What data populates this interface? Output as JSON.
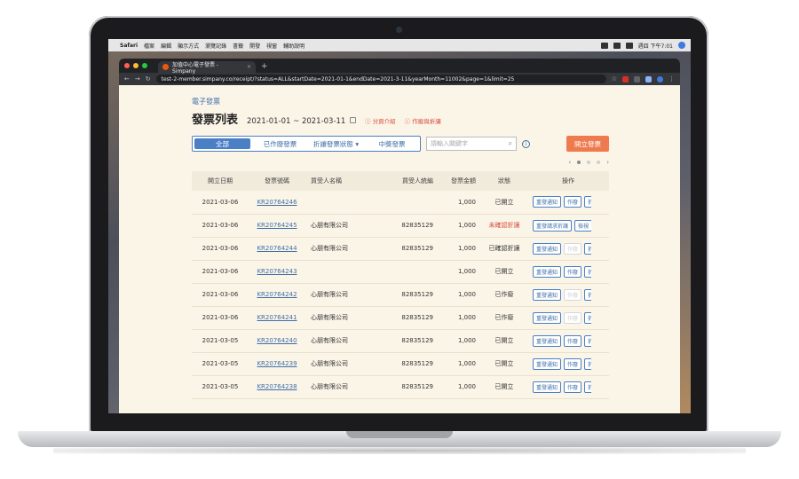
{
  "menubar": {
    "apple": "",
    "app": "Safari",
    "items": [
      "檔案",
      "編輯",
      "顯示方式",
      "瀏覽記錄",
      "書籤",
      "開發",
      "視窗",
      "輔助說明"
    ],
    "clock": "週四 下午7:01"
  },
  "browser": {
    "tab_title": "加值中心電子發票 - Simpany",
    "url": "test-2-member.simpany.co/receipt/?status=ALL&startDate=2021-01-1&endDate=2021-3-11&yearMonth=11002&page=1&limit=25"
  },
  "page": {
    "breadcrumb": "電子發票",
    "title": "發票列表",
    "date_range": "2021-01-01 ~ 2021-03-11",
    "links": [
      "分頁介紹",
      "作廢與折讓"
    ],
    "filters": [
      "全部",
      "已作廢發票",
      "折讓發票狀態",
      "中獎發票"
    ],
    "search_placeholder": "請輸入關鍵字",
    "issue_button": "開立發票"
  },
  "table": {
    "headers": [
      "開立日期",
      "發票號碼",
      "買受人名稱",
      "買受人統編",
      "發票金額",
      "狀態",
      "操作"
    ],
    "rows": [
      {
        "date": "2021-03-06",
        "no": "KR20764246",
        "buyer": "",
        "tax": "",
        "amt": "1,000",
        "status": "已開立",
        "red": false,
        "b1": "重發通知",
        "b2": "作廢",
        "b3": "折讓",
        "b2dis": false
      },
      {
        "date": "2021-03-06",
        "no": "KR20764245",
        "buyer": "心朋有限公司",
        "tax": "82835129",
        "amt": "1,000",
        "status": "未確認折讓",
        "red": true,
        "b1": "重發請求折讓",
        "b2": "檢視",
        "b3": "",
        "b2dis": false
      },
      {
        "date": "2021-03-06",
        "no": "KR20764244",
        "buyer": "心朋有限公司",
        "tax": "82835129",
        "amt": "1,000",
        "status": "已確認折讓",
        "red": false,
        "b1": "重發通知",
        "b2": "作廢",
        "b3": "折讓",
        "b2dis": true
      },
      {
        "date": "2021-03-06",
        "no": "KR20764243",
        "buyer": "",
        "tax": "",
        "amt": "1,000",
        "status": "已開立",
        "red": false,
        "b1": "重發通知",
        "b2": "作廢",
        "b3": "折讓",
        "b2dis": false
      },
      {
        "date": "2021-03-06",
        "no": "KR20764242",
        "buyer": "心朋有限公司",
        "tax": "82835129",
        "amt": "1,000",
        "status": "已作廢",
        "red": false,
        "b1": "重發通知",
        "b2": "作廢",
        "b3": "折讓",
        "b2dis": true
      },
      {
        "date": "2021-03-06",
        "no": "KR20764241",
        "buyer": "心朋有限公司",
        "tax": "82835129",
        "amt": "1,000",
        "status": "已作廢",
        "red": false,
        "b1": "重發通知",
        "b2": "作廢",
        "b3": "折讓",
        "b2dis": true
      },
      {
        "date": "2021-03-05",
        "no": "KR20764240",
        "buyer": "心朋有限公司",
        "tax": "82835129",
        "amt": "1,000",
        "status": "已開立",
        "red": false,
        "b1": "重發通知",
        "b2": "作廢",
        "b3": "折讓",
        "b2dis": false
      },
      {
        "date": "2021-03-05",
        "no": "KR20764239",
        "buyer": "心朋有限公司",
        "tax": "82835129",
        "amt": "1,000",
        "status": "已開立",
        "red": false,
        "b1": "重發通知",
        "b2": "作廢",
        "b3": "折讓",
        "b2dis": false
      },
      {
        "date": "2021-03-05",
        "no": "KR20764238",
        "buyer": "心朋有限公司",
        "tax": "82835129",
        "amt": "1,000",
        "status": "已開立",
        "red": false,
        "b1": "重發通知",
        "b2": "作廢",
        "b3": "折讓",
        "b2dis": false
      }
    ]
  },
  "colors": {
    "accent": "#4a7fc6",
    "primary_button": "#ef7a4e",
    "warning_text": "#d7493b",
    "page_bg": "#fbf5e8"
  }
}
